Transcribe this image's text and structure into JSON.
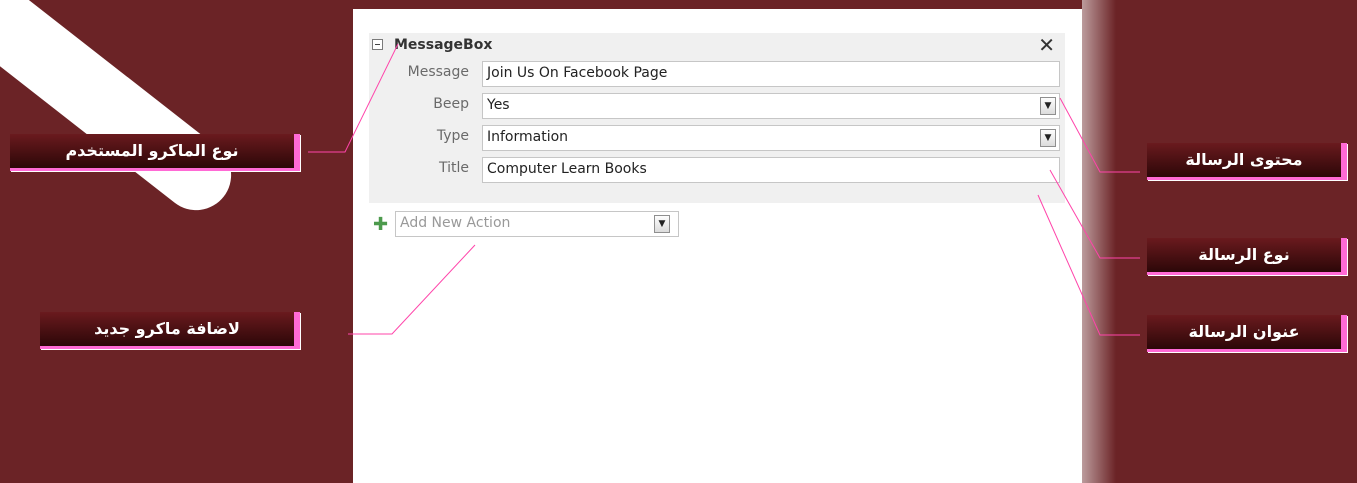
{
  "macro_action": {
    "name": "MessageBox",
    "close_glyph": "✕",
    "collapse_icon": "minus-box-icon",
    "arguments": {
      "message": {
        "label": "Message",
        "value": "Join Us On Facebook Page"
      },
      "beep": {
        "label": "Beep",
        "value": "Yes"
      },
      "type": {
        "label": "Type",
        "value": "Information"
      },
      "title": {
        "label": "Title",
        "value": "Computer Learn Books"
      }
    }
  },
  "add_new_action": {
    "placeholder": "Add New Action",
    "icon": "plus-icon"
  },
  "callouts": {
    "macro_type": "نوع الماكرو المستخدم",
    "add_macro": "لاضافة ماكرو جديد",
    "message_content": "محتوى الرسالة",
    "message_type": "نوع الرسالة",
    "message_title": "عنوان الرسالة"
  },
  "colors": {
    "background": "#6b2326",
    "callout_border": "#ff6ad5",
    "leader_line": "#ff44aa"
  }
}
